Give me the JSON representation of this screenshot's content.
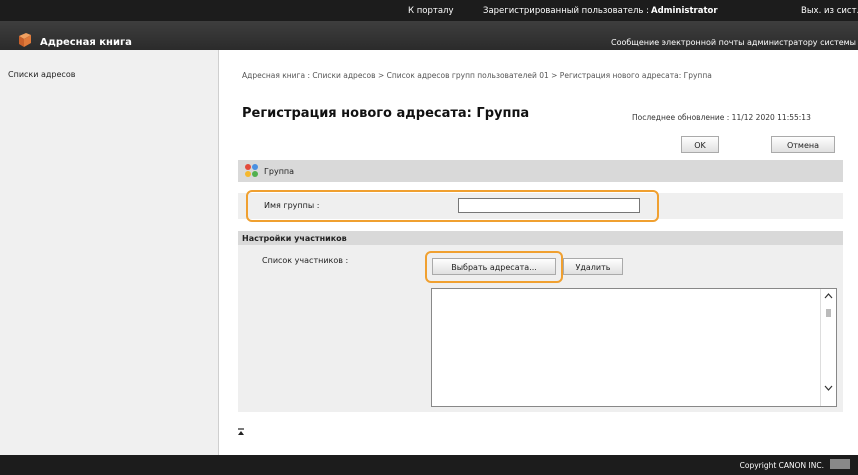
{
  "header": {
    "portal_link": "К порталу",
    "user_label": "Зарегистрированный пользователь :",
    "user_name": "Administrator",
    "logout": "Вых. из сист."
  },
  "app": {
    "title": "Адресная книга",
    "admin_mail_link": "Сообщение электронной почты администратору системы"
  },
  "sidebar": {
    "items": [
      {
        "label": "Списки адресов"
      }
    ]
  },
  "breadcrumb": "Адресная книга : Списки адресов > Список адресов групп пользователей 01 > Регистрация нового адресата: Группа",
  "page": {
    "title": "Регистрация нового адресата: Группа",
    "last_update": "Последнее обновление : 11/12 2020 11:55:13"
  },
  "buttons": {
    "ok": "OK",
    "cancel": "Отмена",
    "select_address": "Выбрать адресата...",
    "delete": "Удалить"
  },
  "group_section": {
    "title": "Группа",
    "name_label": "Имя группы :",
    "name_value": ""
  },
  "members_section": {
    "title": "Настройки участников",
    "list_label": "Список участников :"
  },
  "footer": {
    "copyright": "Copyright CANON INC."
  },
  "colors": {
    "highlight": "#f0a030",
    "header_bg": "#1c1c1c"
  }
}
